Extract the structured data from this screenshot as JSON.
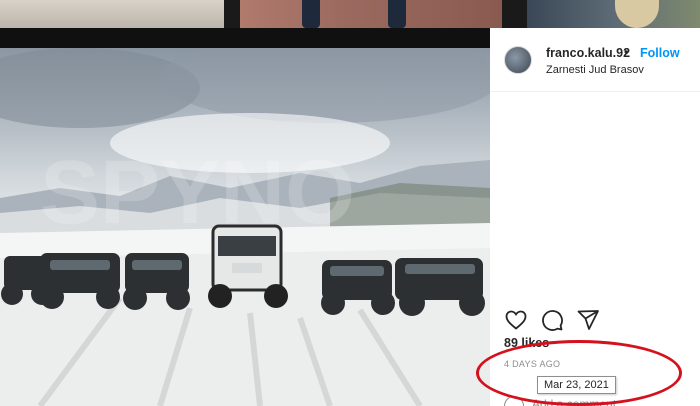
{
  "post": {
    "username": "franco.kalu.92",
    "separator": "•",
    "follow_label": "Follow",
    "location": "Zarnesti Jud Brasov",
    "likes": "89 likes",
    "time_ago": "4 DAYS AGO",
    "date_tooltip": "Mar 23, 2021",
    "comment_placeholder": "Add a comment..."
  },
  "icons": {
    "like": "heart-icon",
    "comment": "comment-icon",
    "share": "share-icon"
  },
  "colors": {
    "follow_blue": "#0095f6",
    "annotation_red": "#d4121e"
  }
}
